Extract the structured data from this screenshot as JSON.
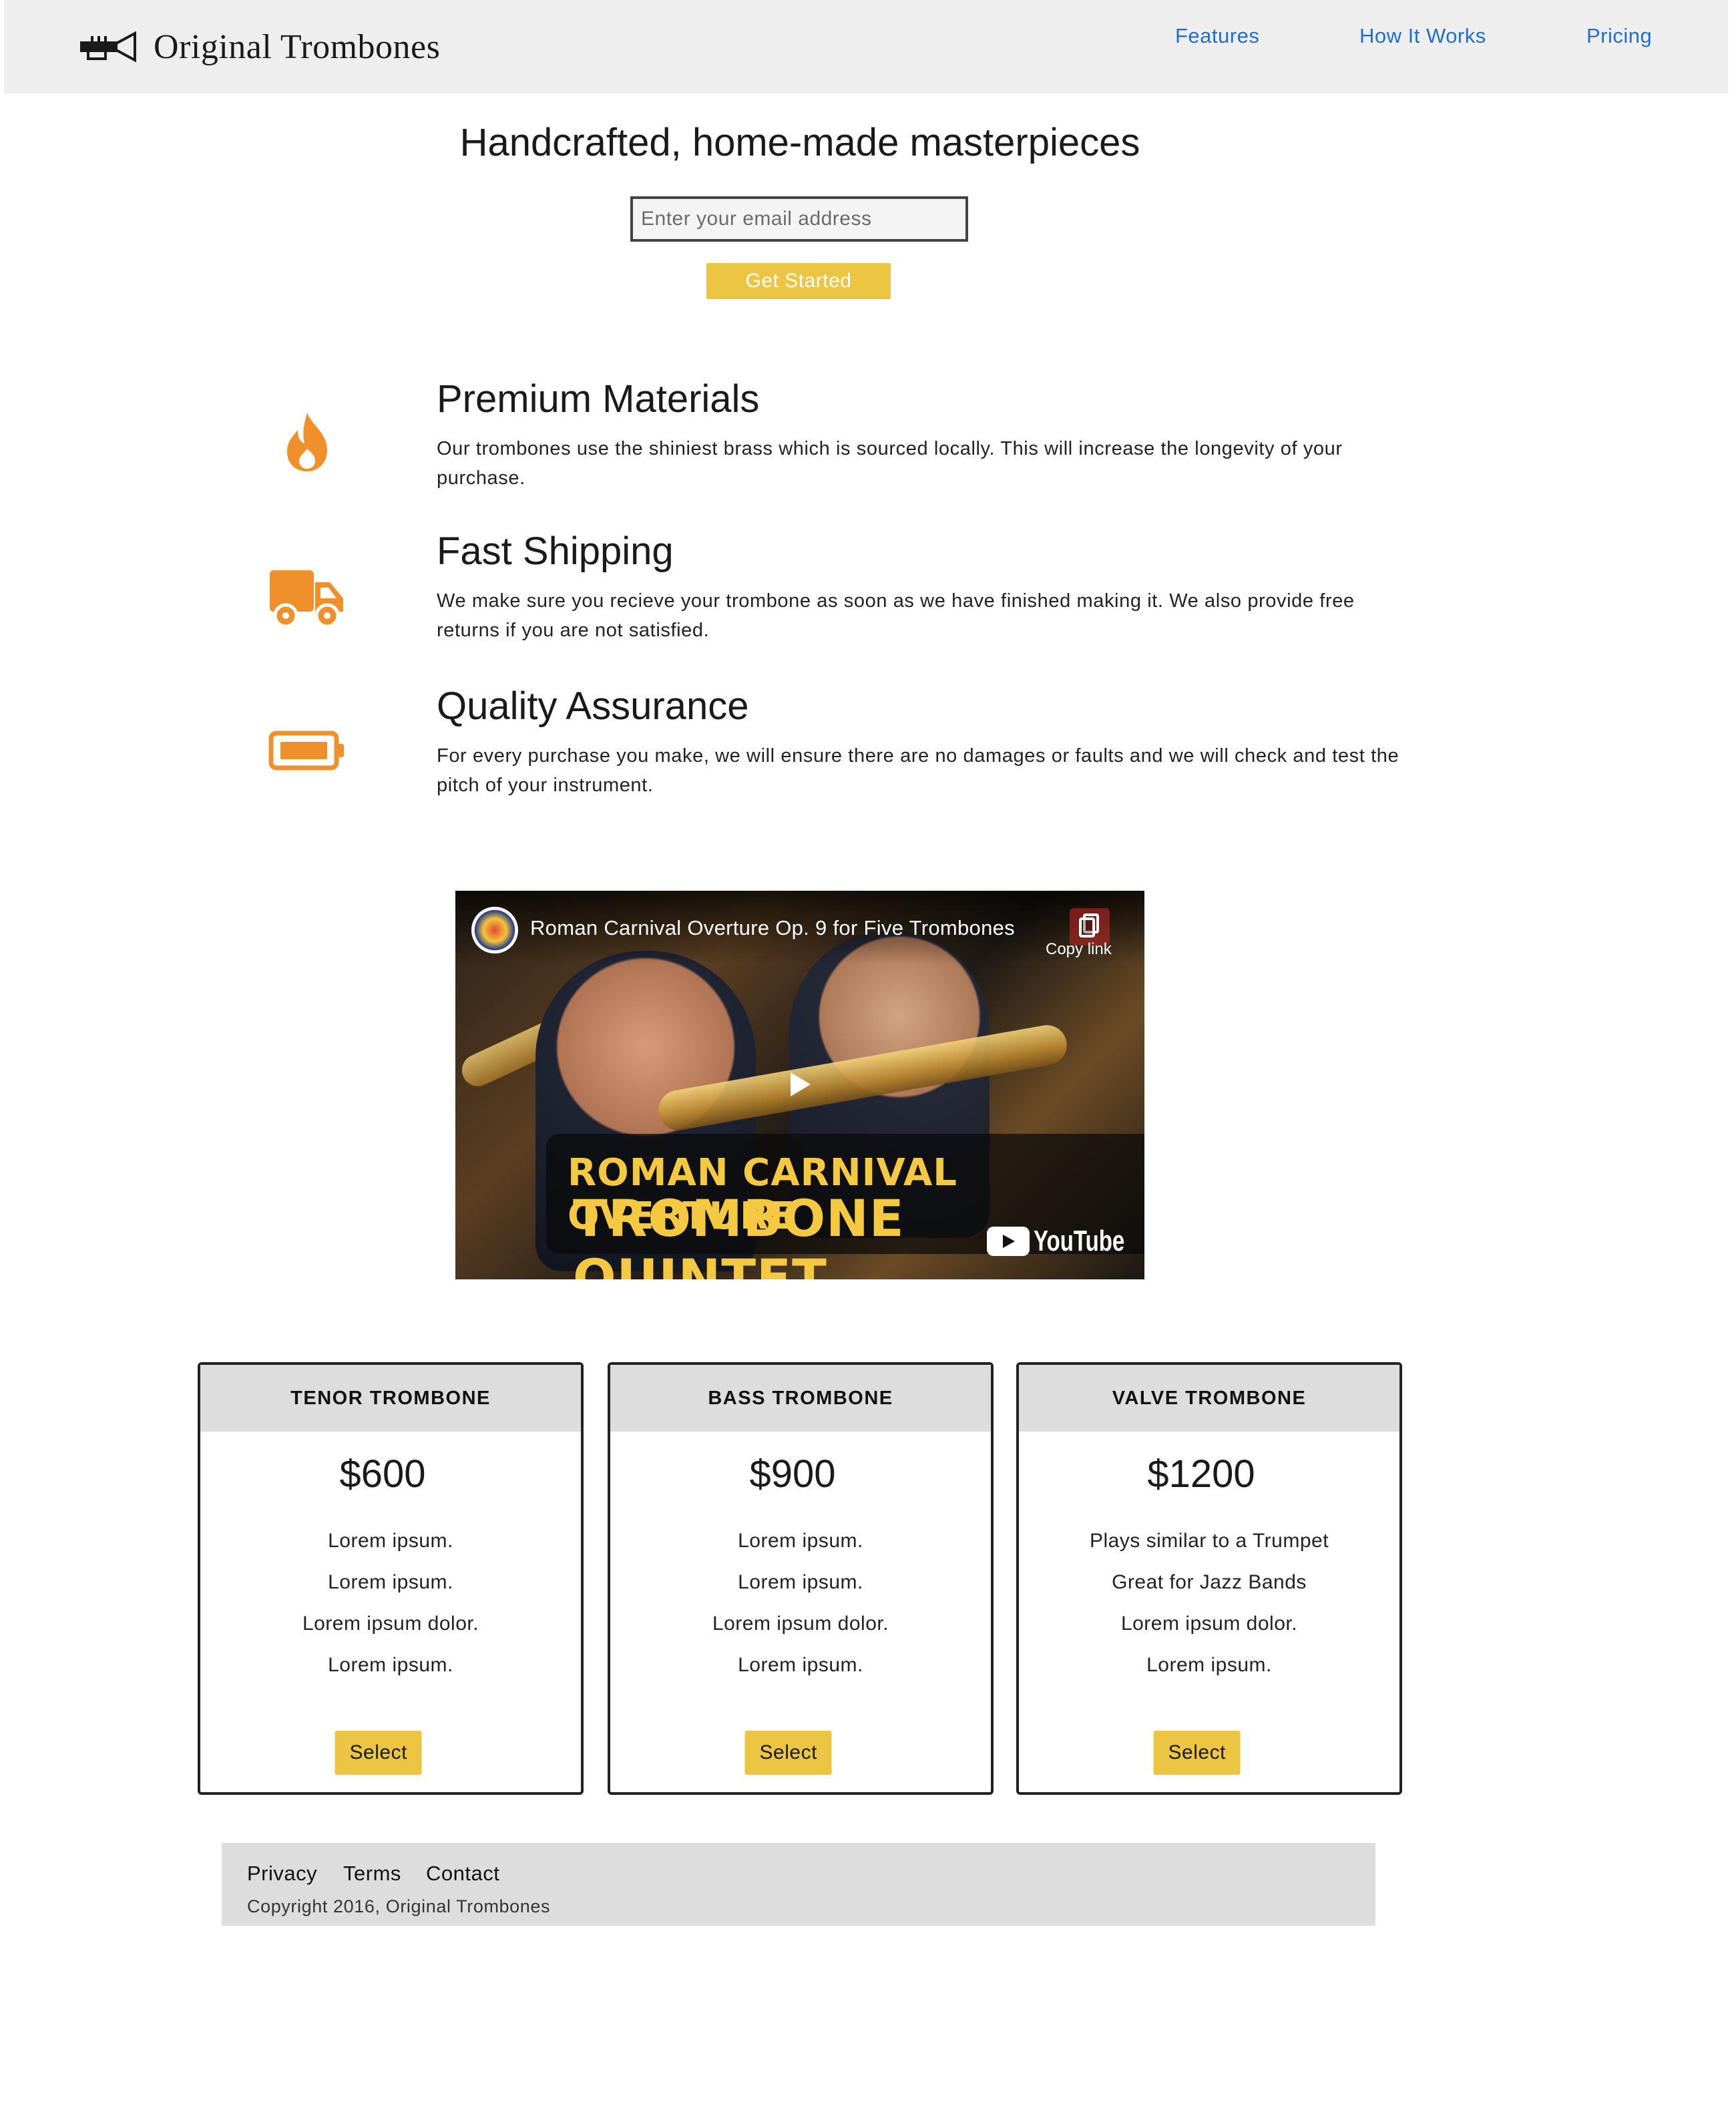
{
  "header": {
    "brand": "Original Trombones",
    "nav": [
      {
        "label": "Features"
      },
      {
        "label": "How It Works"
      },
      {
        "label": "Pricing"
      }
    ]
  },
  "hero": {
    "title": "Handcrafted, home-made masterpieces",
    "email_placeholder": "Enter your email address",
    "email_value": "",
    "cta_label": "Get Started"
  },
  "features": [
    {
      "icon": "fire-icon",
      "title": "Premium Materials",
      "description": "Our trombones use the shiniest brass which is sourced locally. This will increase the longevity of your purchase."
    },
    {
      "icon": "truck-icon",
      "title": "Fast Shipping",
      "description": "We make sure you recieve your trombone as soon as we have finished making it. We also provide free returns if you are not satisfied."
    },
    {
      "icon": "battery-icon",
      "title": "Quality Assurance",
      "description": "For every purchase you make, we will ensure there are no damages or faults and we will check and test the pitch of your instrument."
    }
  ],
  "video": {
    "title": "Roman Carnival Overture Op. 9 for Five Trombones",
    "copy_link_label": "Copy link",
    "banner_line1": "ROMAN CARNIVAL OVERTURE",
    "banner_line2": "TROMBONE QUINTET",
    "platform_label": "YouTube"
  },
  "pricing": [
    {
      "name": "TENOR TROMBONE",
      "price": "$600",
      "features": [
        "Lorem ipsum.",
        "Lorem ipsum.",
        "Lorem ipsum dolor.",
        "Lorem ipsum."
      ],
      "button": "Select"
    },
    {
      "name": "BASS TROMBONE",
      "price": "$900",
      "features": [
        "Lorem ipsum.",
        "Lorem ipsum.",
        "Lorem ipsum dolor.",
        "Lorem ipsum."
      ],
      "button": "Select"
    },
    {
      "name": "VALVE TROMBONE",
      "price": "$1200",
      "features": [
        "Plays similar to a Trumpet",
        "Great for Jazz Bands",
        "Lorem ipsum dolor.",
        "Lorem ipsum."
      ],
      "button": "Select"
    }
  ],
  "footer": {
    "links": [
      {
        "label": "Privacy"
      },
      {
        "label": "Terms"
      },
      {
        "label": "Contact"
      }
    ],
    "copyright": "Copyright 2016, Original Trombones"
  },
  "colors": {
    "accent": "#ecc542",
    "icon": "#f0902a",
    "nav_link": "#1f6fd1",
    "header_bg": "#eeeeee"
  }
}
